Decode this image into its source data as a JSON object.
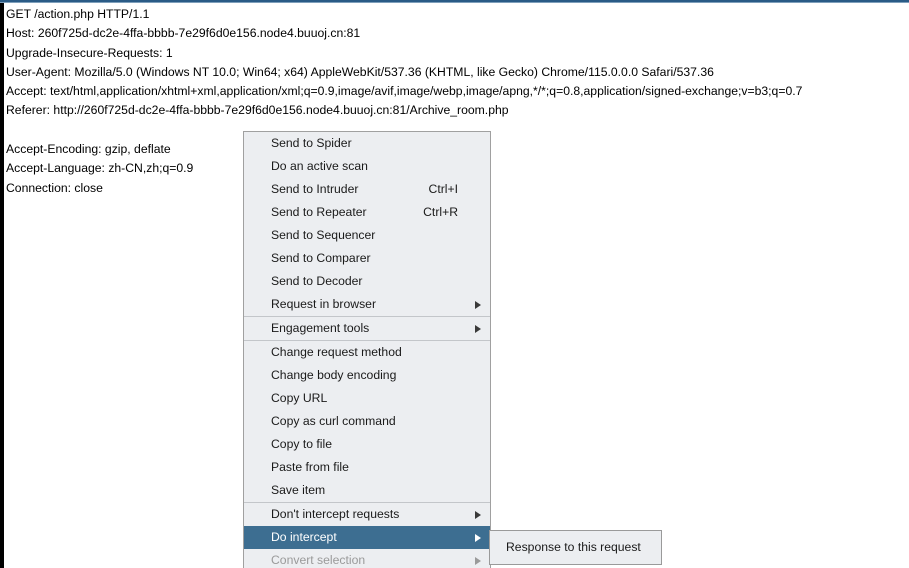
{
  "window": {
    "accent_color": "#2a5b86",
    "menu_bg": "#eceef1",
    "highlight_color": "#3d6e91",
    "text_color": "#000000"
  },
  "request": {
    "lines": [
      "GET /action.php HTTP/1.1",
      "Host: 260f725d-dc2e-4ffa-bbbb-7e29f6d0e156.node4.buuoj.cn:81",
      "Upgrade-Insecure-Requests: 1",
      "User-Agent: Mozilla/5.0 (Windows NT 10.0; Win64; x64) AppleWebKit/537.36 (KHTML, like Gecko) Chrome/115.0.0.0 Safari/537.36",
      "Accept: text/html,application/xhtml+xml,application/xml;q=0.9,image/avif,image/webp,image/apng,*/*;q=0.8,application/signed-exchange;v=b3;q=0.7",
      "Referer: http://260f725d-dc2e-4ffa-bbbb-7e29f6d0e156.node4.buuoj.cn:81/Archive_room.php",
      "",
      "Accept-Encoding: gzip, deflate",
      "Accept-Language: zh-CN,zh;q=0.9",
      "Connection: close"
    ]
  },
  "context_menu": {
    "items": [
      {
        "label": "Send to Spider",
        "accel": "",
        "submenu": false,
        "selected": false,
        "disabled": false,
        "separator_after": false
      },
      {
        "label": "Do an active scan",
        "accel": "",
        "submenu": false,
        "selected": false,
        "disabled": false,
        "separator_after": false
      },
      {
        "label": "Send to Intruder",
        "accel": "Ctrl+I",
        "submenu": false,
        "selected": false,
        "disabled": false,
        "separator_after": false
      },
      {
        "label": "Send to Repeater",
        "accel": "Ctrl+R",
        "submenu": false,
        "selected": false,
        "disabled": false,
        "separator_after": false
      },
      {
        "label": "Send to Sequencer",
        "accel": "",
        "submenu": false,
        "selected": false,
        "disabled": false,
        "separator_after": false
      },
      {
        "label": "Send to Comparer",
        "accel": "",
        "submenu": false,
        "selected": false,
        "disabled": false,
        "separator_after": false
      },
      {
        "label": "Send to Decoder",
        "accel": "",
        "submenu": false,
        "selected": false,
        "disabled": false,
        "separator_after": false
      },
      {
        "label": "Request in browser",
        "accel": "",
        "submenu": true,
        "selected": false,
        "disabled": false,
        "separator_after": true
      },
      {
        "label": "Engagement tools",
        "accel": "",
        "submenu": true,
        "selected": false,
        "disabled": false,
        "separator_after": true
      },
      {
        "label": "Change request method",
        "accel": "",
        "submenu": false,
        "selected": false,
        "disabled": false,
        "separator_after": false
      },
      {
        "label": "Change body encoding",
        "accel": "",
        "submenu": false,
        "selected": false,
        "disabled": false,
        "separator_after": false
      },
      {
        "label": "Copy URL",
        "accel": "",
        "submenu": false,
        "selected": false,
        "disabled": false,
        "separator_after": false
      },
      {
        "label": "Copy as curl command",
        "accel": "",
        "submenu": false,
        "selected": false,
        "disabled": false,
        "separator_after": false
      },
      {
        "label": "Copy to file",
        "accel": "",
        "submenu": false,
        "selected": false,
        "disabled": false,
        "separator_after": false
      },
      {
        "label": "Paste from file",
        "accel": "",
        "submenu": false,
        "selected": false,
        "disabled": false,
        "separator_after": false
      },
      {
        "label": "Save item",
        "accel": "",
        "submenu": false,
        "selected": false,
        "disabled": false,
        "separator_after": true
      },
      {
        "label": "Don't intercept requests",
        "accel": "",
        "submenu": true,
        "selected": false,
        "disabled": false,
        "separator_after": false
      },
      {
        "label": "Do intercept",
        "accel": "",
        "submenu": true,
        "selected": true,
        "disabled": false,
        "separator_after": false
      },
      {
        "label": "Convert selection",
        "accel": "",
        "submenu": true,
        "selected": false,
        "disabled": true,
        "separator_after": false
      }
    ]
  },
  "submenu": {
    "items": [
      {
        "label": "Response to this request",
        "accel": "",
        "submenu": false,
        "selected": false,
        "disabled": false,
        "separator_after": false
      }
    ]
  }
}
